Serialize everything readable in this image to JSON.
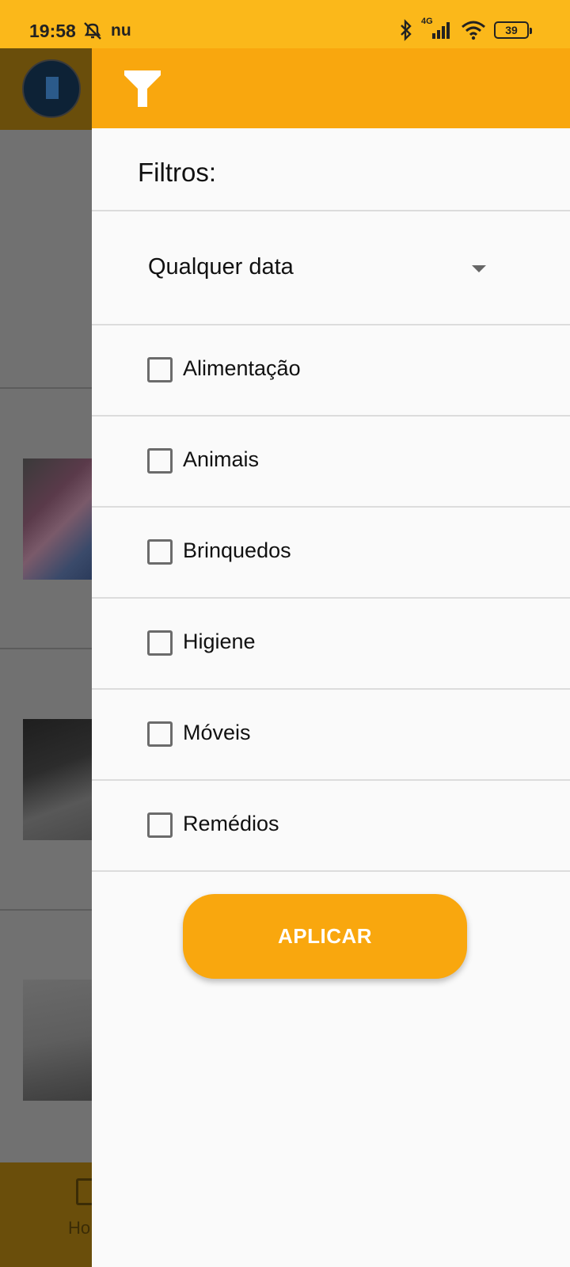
{
  "status_bar": {
    "time": "19:58",
    "carrier_icon_text": "nu",
    "network_type": "4G",
    "battery_level": "39",
    "icons": [
      "muted-alarm-icon",
      "bluetooth-icon",
      "signal-icon",
      "wifi-icon",
      "battery-icon"
    ]
  },
  "background_app": {
    "bottom_nav_label": "Ho"
  },
  "drawer": {
    "header_icon": "filter-icon",
    "title": "Filtros:",
    "date_filter": {
      "selected": "Qualquer data"
    },
    "categories": [
      {
        "label": "Alimentação",
        "checked": false
      },
      {
        "label": "Animais",
        "checked": false
      },
      {
        "label": "Brinquedos",
        "checked": false
      },
      {
        "label": "Higiene",
        "checked": false
      },
      {
        "label": "Móveis",
        "checked": false
      },
      {
        "label": "Remédios",
        "checked": false
      }
    ],
    "apply_label": "APLICAR"
  },
  "colors": {
    "accent": "#f9a70e",
    "status_bar": "#fbb81a",
    "scrim_header": "#6a4e0b"
  }
}
